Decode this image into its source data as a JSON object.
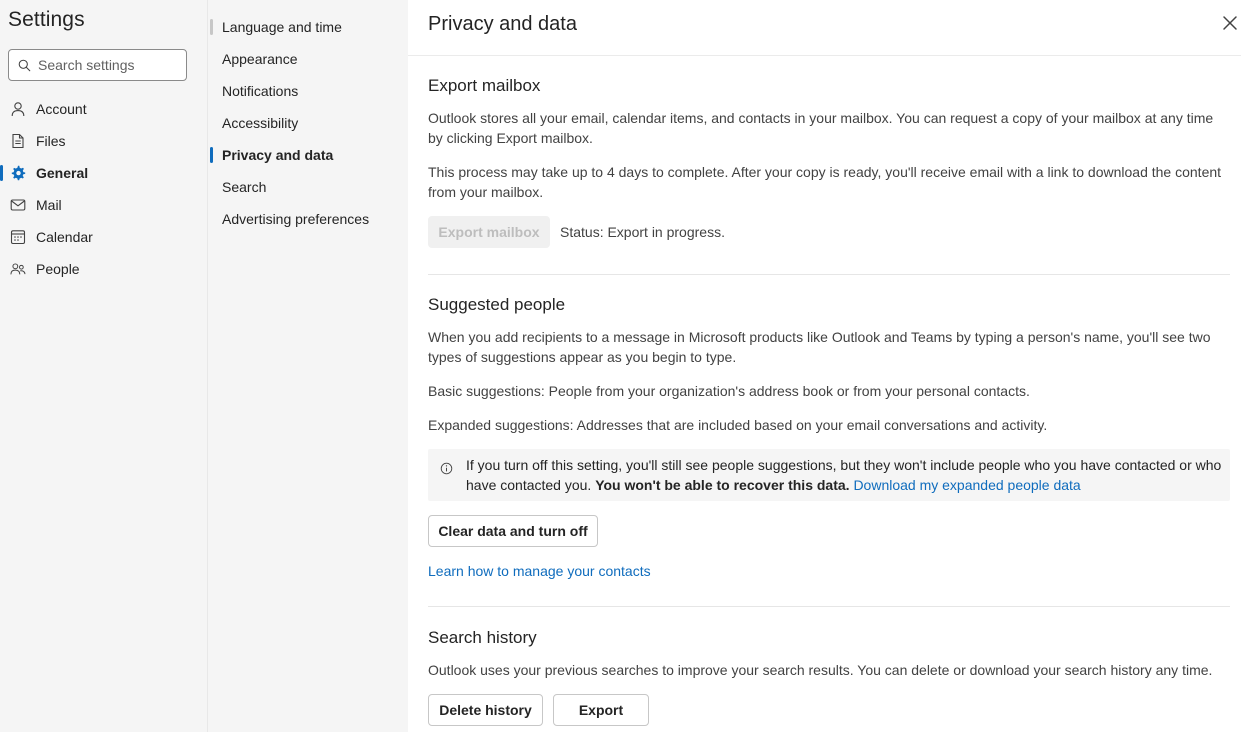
{
  "nav": {
    "title": "Settings",
    "search_placeholder": "Search settings",
    "items": [
      {
        "label": "Account",
        "icon": "person-icon"
      },
      {
        "label": "Files",
        "icon": "file-icon"
      },
      {
        "label": "General",
        "icon": "gear-icon"
      },
      {
        "label": "Mail",
        "icon": "mail-icon"
      },
      {
        "label": "Calendar",
        "icon": "calendar-icon"
      },
      {
        "label": "People",
        "icon": "people-icon"
      }
    ],
    "active": "General"
  },
  "subnav": {
    "items": [
      "Language and time",
      "Appearance",
      "Notifications",
      "Accessibility",
      "Privacy and data",
      "Search",
      "Advertising preferences"
    ],
    "active": "Privacy and data"
  },
  "main": {
    "title": "Privacy and data",
    "export_mailbox": {
      "title": "Export mailbox",
      "para1": "Outlook stores all your email, calendar items, and contacts in your mailbox. You can request a copy of your mailbox at any time by clicking Export mailbox.",
      "para2": "This process may take up to 4 days to complete. After your copy is ready, you'll receive email with a link to download the content from your mailbox.",
      "button": "Export mailbox",
      "status": "Status: Export in progress."
    },
    "suggested_people": {
      "title": "Suggested people",
      "para1": "When you add recipients to a message in Microsoft products like Outlook and Teams by typing a person's name, you'll see two types of suggestions appear as you begin to type.",
      "basic": "Basic suggestions: People from your organization's address book or from your personal contacts.",
      "expanded": "Expanded suggestions: Addresses that are included based on your email conversations and activity.",
      "info_text": "If you turn off this setting, you'll still see people suggestions, but they won't include people who you have contacted or who have contacted you.",
      "info_bold": "You won't be able to recover this data.",
      "info_link": "Download my expanded people data",
      "clear_button": "Clear data and turn off",
      "learn_link": "Learn how to manage your contacts"
    },
    "search_history": {
      "title": "Search history",
      "para": "Outlook uses your previous searches to improve your search results. You can delete or download your search history any time.",
      "delete_button": "Delete history",
      "export_button": "Export"
    }
  },
  "colors": {
    "accent": "#0f6cbd",
    "nav_bg": "#f5f5f5"
  }
}
